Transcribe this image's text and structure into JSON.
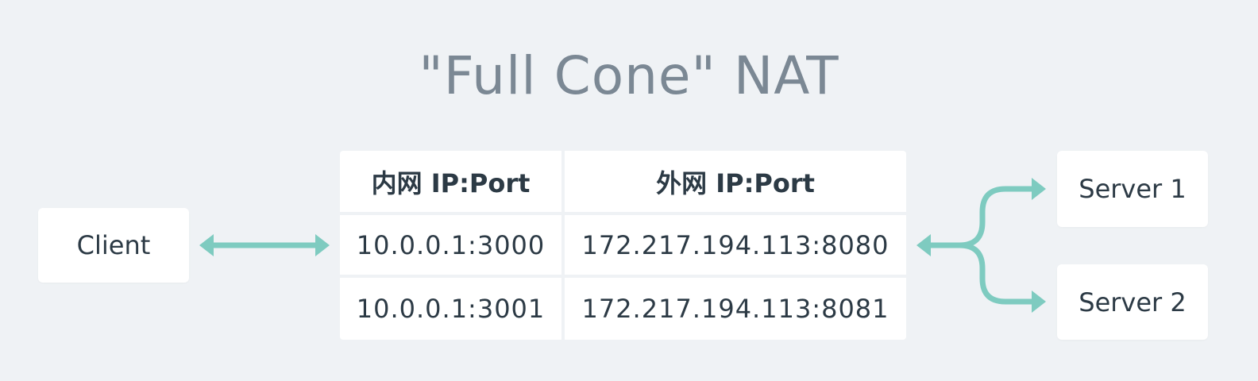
{
  "diagram": {
    "title": "\"Full Cone\" NAT",
    "client_label": "Client",
    "servers": [
      "Server 1",
      "Server 2"
    ],
    "table": {
      "headers": [
        "内网 IP:Port",
        "外网 IP:Port"
      ],
      "rows": [
        [
          "10.0.0.1:3000",
          "172.217.194.113:8080"
        ],
        [
          "10.0.0.1:3001",
          "172.217.194.113:8081"
        ]
      ]
    },
    "arrow_color": "#7ecbc0"
  }
}
